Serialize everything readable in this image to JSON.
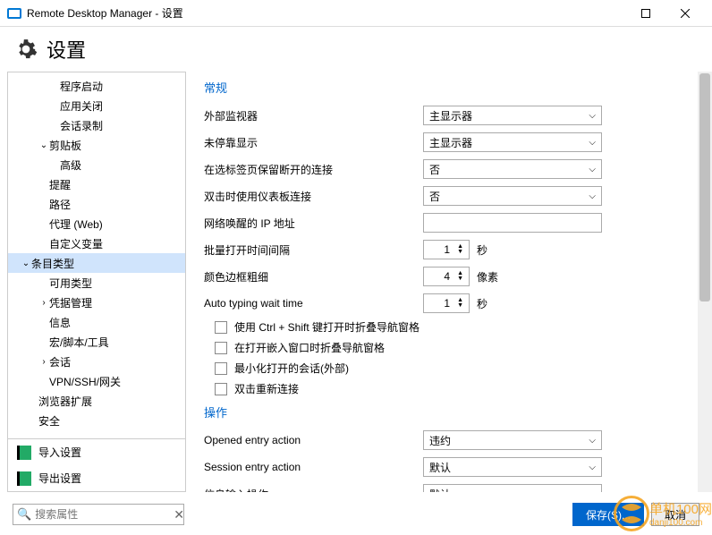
{
  "titlebar": {
    "app_name": "Remote Desktop Manager - 设置"
  },
  "header": {
    "title": "设置"
  },
  "sidebar": {
    "items": [
      {
        "label": "程序启动",
        "indent": 40,
        "chevron": ""
      },
      {
        "label": "应用关闭",
        "indent": 40,
        "chevron": ""
      },
      {
        "label": "会话录制",
        "indent": 40,
        "chevron": ""
      },
      {
        "label": "剪贴板",
        "indent": 28,
        "chevron": "⌄"
      },
      {
        "label": "高级",
        "indent": 40,
        "chevron": ""
      },
      {
        "label": "提醒",
        "indent": 28,
        "chevron": ""
      },
      {
        "label": "路径",
        "indent": 28,
        "chevron": ""
      },
      {
        "label": "代理 (Web)",
        "indent": 28,
        "chevron": ""
      },
      {
        "label": "自定义变量",
        "indent": 28,
        "chevron": ""
      },
      {
        "label": "条目类型",
        "indent": 8,
        "chevron": "⌄",
        "selected": true
      },
      {
        "label": "可用类型",
        "indent": 28,
        "chevron": ""
      },
      {
        "label": "凭据管理",
        "indent": 28,
        "chevron": "›"
      },
      {
        "label": "信息",
        "indent": 28,
        "chevron": ""
      },
      {
        "label": "宏/脚本/工具",
        "indent": 28,
        "chevron": ""
      },
      {
        "label": "会话",
        "indent": 28,
        "chevron": "›"
      },
      {
        "label": "VPN/SSH/网关",
        "indent": 28,
        "chevron": ""
      },
      {
        "label": "浏览器扩展",
        "indent": 16,
        "chevron": ""
      },
      {
        "label": "安全",
        "indent": 16,
        "chevron": ""
      }
    ],
    "import_btn": "导入设置",
    "export_btn": "导出设置"
  },
  "content": {
    "section1_title": "常规",
    "rows": [
      {
        "label": "外部监视器",
        "type": "select",
        "value": "主显示器"
      },
      {
        "label": "未停靠显示",
        "type": "select",
        "value": "主显示器"
      },
      {
        "label": "在选标签页保留断开的连接",
        "type": "select",
        "value": "否"
      },
      {
        "label": "双击时使用仪表板连接",
        "type": "select",
        "value": "否"
      },
      {
        "label": "网络唤醒的 IP 地址",
        "type": "input",
        "value": ""
      },
      {
        "label": "批量打开时间间隔",
        "type": "spinner",
        "value": "1",
        "unit": "秒"
      },
      {
        "label": "颜色边框粗细",
        "type": "spinner",
        "value": "4",
        "unit": "像素"
      },
      {
        "label": "Auto typing wait time",
        "type": "spinner",
        "value": "1",
        "unit": "秒"
      }
    ],
    "checkboxes": [
      "使用 Ctrl + Shift 键打开时折叠导航窗格",
      "在打开嵌入窗口时折叠导航窗格",
      "最小化打开的会话(外部)",
      "双击重新连接"
    ],
    "section2_title": "操作",
    "rows2": [
      {
        "label": "Opened entry action",
        "type": "select",
        "value": "违约"
      },
      {
        "label": "Session entry action",
        "type": "select",
        "value": "默认"
      },
      {
        "label": "信息输入操作",
        "type": "select",
        "value": "默认"
      }
    ]
  },
  "bottom": {
    "search_placeholder": "搜索属性",
    "save": "保存(S)...",
    "cancel": "取消"
  },
  "watermark": {
    "brand": "单机100网",
    "url": "danji100.com"
  }
}
